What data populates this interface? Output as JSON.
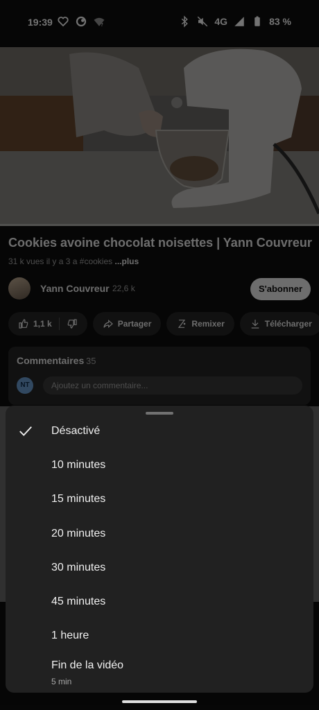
{
  "status_bar": {
    "time": "19:39",
    "network": "4G",
    "battery": "83 %",
    "left_icons": [
      "heart-icon",
      "sync-icon",
      "wifi-question-icon"
    ],
    "right_icons": [
      "bluetooth-icon",
      "mute-icon",
      "signal-icon",
      "battery-icon"
    ]
  },
  "video": {
    "title": "Cookies avoine chocolat noisettes | Yann Couvreur",
    "views": "31 k vues",
    "age": "il y a 3 a",
    "hashtag": "#cookies",
    "more": "...plus"
  },
  "channel": {
    "name": "Yann Couvreur",
    "subscribers": "22,6 k",
    "subscribe_label": "S'abonner"
  },
  "actions": {
    "likes": "1,1 k",
    "share": "Partager",
    "remix": "Remixer",
    "download": "Télécharger"
  },
  "comments": {
    "title": "Commentaires",
    "count": "35",
    "avatar_initials": "NT",
    "placeholder": "Ajoutez un commentaire..."
  },
  "sleep_timer_sheet": {
    "selected": "Désactivé",
    "options": [
      {
        "label": "Désactivé",
        "selected": true
      },
      {
        "label": "10 minutes",
        "selected": false
      },
      {
        "label": "15 minutes",
        "selected": false
      },
      {
        "label": "20 minutes",
        "selected": false
      },
      {
        "label": "30 minutes",
        "selected": false
      },
      {
        "label": "45 minutes",
        "selected": false
      },
      {
        "label": "1 heure",
        "selected": false
      },
      {
        "label": "Fin de la vidéo",
        "sub": "5 min",
        "selected": false
      }
    ]
  }
}
